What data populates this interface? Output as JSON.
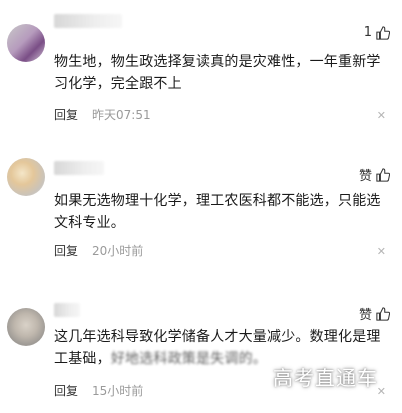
{
  "comments": [
    {
      "text": "物生地，物生政选择复读真的是灾难性，一年重新学习化学，完全跟不上",
      "reply_label": "回复",
      "time": "昨天07:51",
      "like_count": "1"
    },
    {
      "text": "如果无选物理十化学，理工农医科都不能选，只能选文科专业。",
      "reply_label": "回复",
      "time": "20小时前",
      "like_label": "赞"
    },
    {
      "text": "这几年选科导致化学储备人才大量减少。数理化是理工基础，",
      "text_tail": "好地选科政策是失调的。",
      "reply_label": "回复",
      "time": "15小时前",
      "like_label": "赞"
    }
  ],
  "watermark": "高考直通车",
  "colors": {
    "time": "#9a9a9a",
    "text": "#1a1a1a",
    "close": "#b5b5b5"
  },
  "icons": {
    "like": "thumbs-up-icon",
    "close": "close-icon"
  }
}
